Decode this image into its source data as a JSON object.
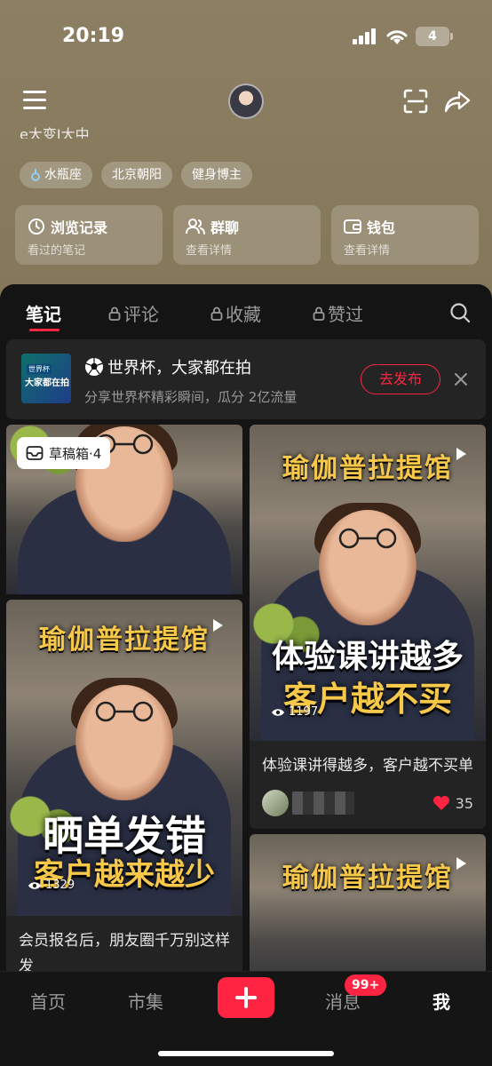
{
  "status_bar": {
    "time": "20:19",
    "battery": "4"
  },
  "profile": {
    "bio": "e大变I大中",
    "tags": [
      {
        "icon": "aquarius-icon",
        "label": "水瓶座"
      },
      {
        "label": "北京朝阳"
      },
      {
        "label": "健身博主"
      }
    ],
    "cards": [
      {
        "icon": "clock-icon",
        "title": "浏览记录",
        "sub": "看过的笔记"
      },
      {
        "icon": "group-icon",
        "title": "群聊",
        "sub": "查看详情"
      },
      {
        "icon": "wallet-icon",
        "title": "钱包",
        "sub": "查看详情"
      }
    ]
  },
  "tabs": [
    {
      "label": "笔记",
      "locked": false,
      "active": true
    },
    {
      "label": "评论",
      "locked": true
    },
    {
      "label": "收藏",
      "locked": true
    },
    {
      "label": "赞过",
      "locked": true
    }
  ],
  "banner": {
    "logo_line1": "世界杯",
    "logo_line2": "大家都在拍",
    "title": "世界杯，大家都在拍",
    "subtitle": "分享世界杯精彩瞬间，瓜分 2亿流量",
    "button": "去发布"
  },
  "draft": {
    "label": "草稿箱·4"
  },
  "notes": {
    "left2": {
      "top_text": "瑜伽普拉提馆",
      "big_text": "晒单发错",
      "red_text": "客户越来越少",
      "views": "1329",
      "title": "会员报名后，朋友圈千万别这样发"
    },
    "right1": {
      "top_text": "瑜伽普拉提馆",
      "big_text": "体验课讲越多",
      "red_text": "客户越不买",
      "views": "1197",
      "title": "体验课讲得越多，客户越不买单",
      "likes": "35"
    },
    "right2": {
      "top_text": "瑜伽普拉提馆"
    }
  },
  "bottom_nav": {
    "home": "首页",
    "market": "市集",
    "messages": "消息",
    "messages_badge": "99+",
    "me": "我"
  },
  "colors": {
    "accent": "#ff2442",
    "overlay_yellow": "#f7c84a",
    "panel_bg": "#141414"
  }
}
